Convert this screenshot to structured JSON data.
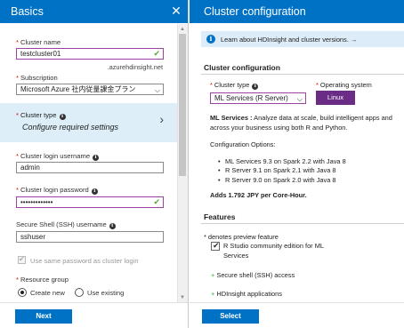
{
  "left": {
    "title": "Basics",
    "close_glyph": "✕",
    "cluster_name": {
      "label": "Cluster name",
      "value": "testcluster01",
      "suffix": ".azurehdinsight.net"
    },
    "subscription": {
      "label": "Subscription",
      "value": "Microsoft Azure 社内従量課金プラン"
    },
    "cluster_type": {
      "label": "Cluster type",
      "value": "Configure required settings"
    },
    "login_username": {
      "label": "Cluster login username",
      "value": "admin"
    },
    "login_password": {
      "label": "Cluster login password",
      "value": "•••••••••••••"
    },
    "ssh_username": {
      "label": "Secure Shell (SSH) username",
      "value": "sshuser"
    },
    "same_password": {
      "label": "Use same password as cluster login"
    },
    "resource_group": {
      "label": "Resource group",
      "create_new": "Create new",
      "use_existing": "Use existing"
    },
    "next_button": "Next"
  },
  "right": {
    "title": "Cluster configuration",
    "banner": "Learn about HDInsight and cluster versions. →",
    "section1": "Cluster configuration",
    "cluster_type": {
      "label": "Cluster type",
      "value": "ML Services (R Server)"
    },
    "os": {
      "label": "Operating system",
      "value": "Linux"
    },
    "desc_bold": "ML Services :",
    "desc_line1": " Analyze data at scale, build intelligent apps and",
    "desc_line2": "across your business using both R and Python.",
    "config_heading": "Configuration Options:",
    "options": [
      "ML Services 9.3 on Spark 2.2 with Java 8",
      "R Server 9.1 on Spark 2.1 with Java 8",
      "R Server 9.0 on Spark 2.0 with Java 8"
    ],
    "price": "Adds 1.792 JPY per Core-Hour.",
    "features_heading": "Features",
    "preview_note": "* denotes preview feature",
    "feature_rstudio_line1": "R Studio community edition for ML",
    "feature_rstudio_line2": "Services",
    "feature_ssh": "Secure shell (SSH) access",
    "feature_apps": "HDInsight applications",
    "select_button": "Select"
  }
}
